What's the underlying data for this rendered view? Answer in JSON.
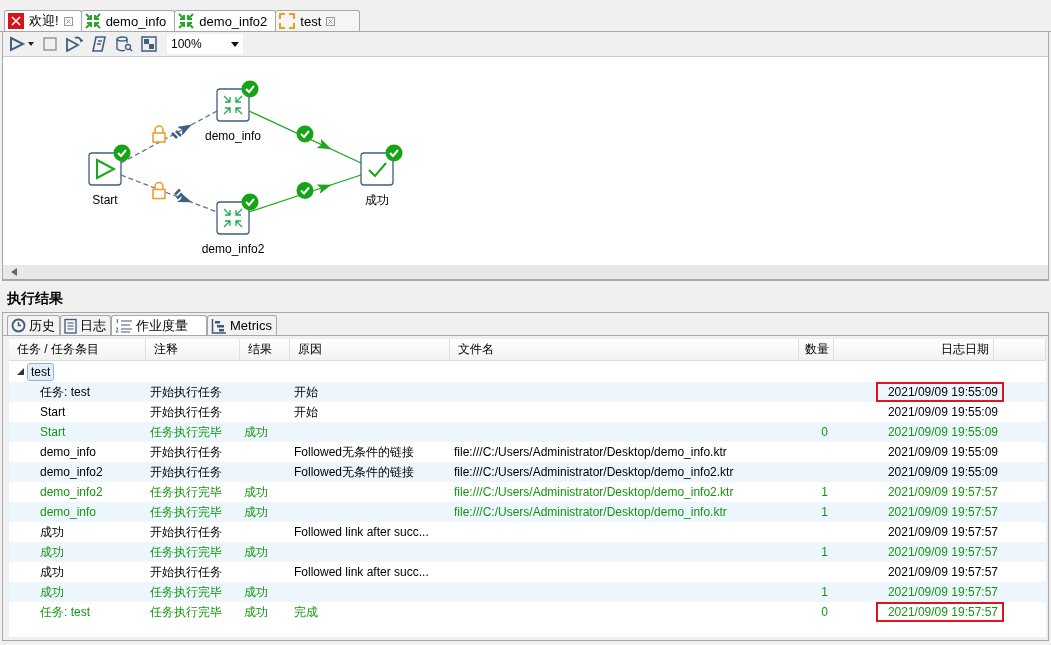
{
  "editor_tabs": [
    {
      "label": "欢迎!",
      "kind": "welcome",
      "selected": false,
      "closable": true
    },
    {
      "label": "demo_info",
      "kind": "transform",
      "selected": false,
      "closable": false
    },
    {
      "label": "demo_info2",
      "kind": "transform",
      "selected": false,
      "closable": false
    },
    {
      "label": "test",
      "kind": "job",
      "selected": true,
      "closable": true
    }
  ],
  "toolbar": {
    "zoom": "100%"
  },
  "canvas": {
    "nodes": [
      {
        "label": "Start",
        "kind": "start",
        "done": true
      },
      {
        "label": "demo_info",
        "kind": "transform",
        "done": true
      },
      {
        "label": "demo_info2",
        "kind": "transform",
        "done": true
      },
      {
        "label": "成功",
        "kind": "success",
        "done": true
      }
    ],
    "hops": [
      {
        "kind": "unconditional",
        "done": false
      },
      {
        "kind": "unconditional",
        "done": false
      },
      {
        "kind": "success",
        "done": true
      },
      {
        "kind": "success",
        "done": true
      }
    ]
  },
  "results": {
    "title": "执行结果",
    "tabs": [
      {
        "label": "历史",
        "kind": "history",
        "selected": false
      },
      {
        "label": "日志",
        "kind": "log",
        "selected": false
      },
      {
        "label": "作业度量",
        "kind": "metrics-list",
        "selected": true
      },
      {
        "label": "Metrics",
        "kind": "chart",
        "selected": false
      }
    ],
    "columns": [
      "任务 / 任务条目",
      "注释",
      "结果",
      "原因",
      "文件名",
      "数量",
      "日志日期"
    ],
    "tree_root": "test",
    "rows": [
      {
        "kind": "start",
        "highlighted": true,
        "cells": [
          "任务: test",
          "开始执行任务",
          "",
          "开始",
          "",
          "",
          "2021/09/09 19:55:09"
        ]
      },
      {
        "kind": "start",
        "highlighted": false,
        "cells": [
          "Start",
          "开始执行任务",
          "",
          "开始",
          "",
          "",
          "2021/09/09 19:55:09"
        ]
      },
      {
        "kind": "done",
        "highlighted": false,
        "cells": [
          "Start",
          "任务执行完毕",
          "成功",
          "",
          "",
          "0",
          "2021/09/09 19:55:09"
        ]
      },
      {
        "kind": "start",
        "highlighted": false,
        "cells": [
          "demo_info",
          "开始执行任务",
          "",
          "Followed无条件的链接",
          "file:///C:/Users/Administrator/Desktop/demo_info.ktr",
          "",
          "2021/09/09 19:55:09"
        ]
      },
      {
        "kind": "start",
        "highlighted": false,
        "cells": [
          "demo_info2",
          "开始执行任务",
          "",
          "Followed无条件的链接",
          "file:///C:/Users/Administrator/Desktop/demo_info2.ktr",
          "",
          "2021/09/09 19:55:09"
        ]
      },
      {
        "kind": "done",
        "highlighted": false,
        "cells": [
          "demo_info2",
          "任务执行完毕",
          "成功",
          "",
          "file:///C:/Users/Administrator/Desktop/demo_info2.ktr",
          "1",
          "2021/09/09 19:57:57"
        ]
      },
      {
        "kind": "done",
        "highlighted": false,
        "cells": [
          "demo_info",
          "任务执行完毕",
          "成功",
          "",
          "file:///C:/Users/Administrator/Desktop/demo_info.ktr",
          "1",
          "2021/09/09 19:57:57"
        ]
      },
      {
        "kind": "start",
        "highlighted": false,
        "cells": [
          "成功",
          "开始执行任务",
          "",
          "Followed link after succ...",
          "",
          "",
          "2021/09/09 19:57:57"
        ]
      },
      {
        "kind": "done",
        "highlighted": false,
        "cells": [
          "成功",
          "任务执行完毕",
          "成功",
          "",
          "",
          "1",
          "2021/09/09 19:57:57"
        ]
      },
      {
        "kind": "start",
        "highlighted": false,
        "cells": [
          "成功",
          "开始执行任务",
          "",
          "Followed link after succ...",
          "",
          "",
          "2021/09/09 19:57:57"
        ]
      },
      {
        "kind": "done",
        "highlighted": false,
        "cells": [
          "成功",
          "任务执行完毕",
          "成功",
          "",
          "",
          "1",
          "2021/09/09 19:57:57"
        ]
      },
      {
        "kind": "done",
        "highlighted": true,
        "cells": [
          "任务: test",
          "任务执行完毕",
          "成功",
          "完成",
          "",
          "0",
          "2021/09/09 19:57:57"
        ]
      }
    ]
  }
}
